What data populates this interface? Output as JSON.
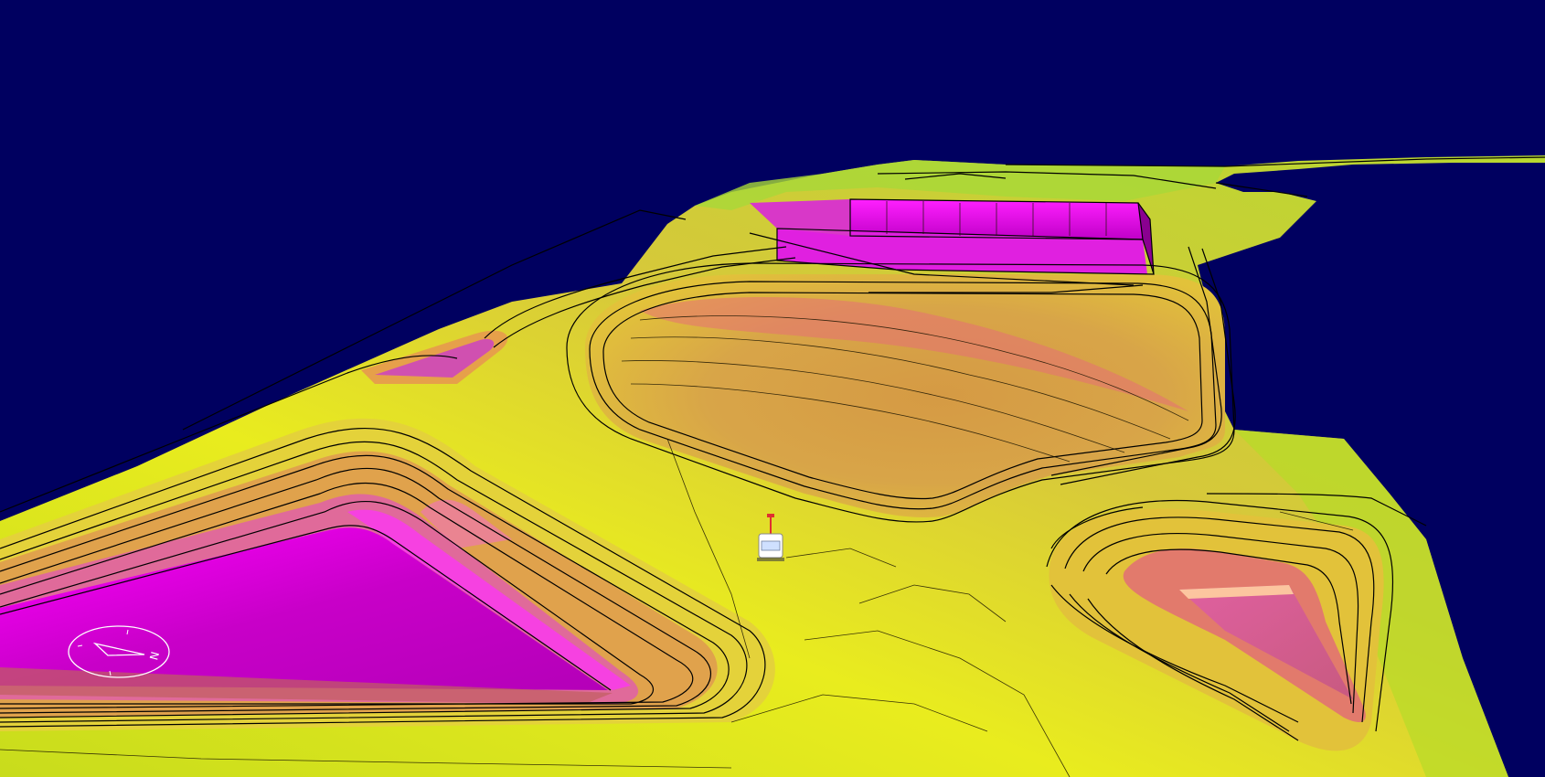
{
  "viewport": {
    "background_color": "#000060",
    "render_mode": "3d-terrain-surface"
  },
  "terrain": {
    "colors": {
      "low": "#c6d81a",
      "mid": "#e8e81a",
      "high": "#d9a040",
      "peak": "#c800c8",
      "highlight": "#ff00ff"
    }
  },
  "vehicle": {
    "icon": "survey-vehicle-icon",
    "color": "#ffffff",
    "mast_color": "#e03030"
  },
  "compass": {
    "icon": "north-arrow-compass-icon",
    "label": "N",
    "color": "#ffffff"
  }
}
